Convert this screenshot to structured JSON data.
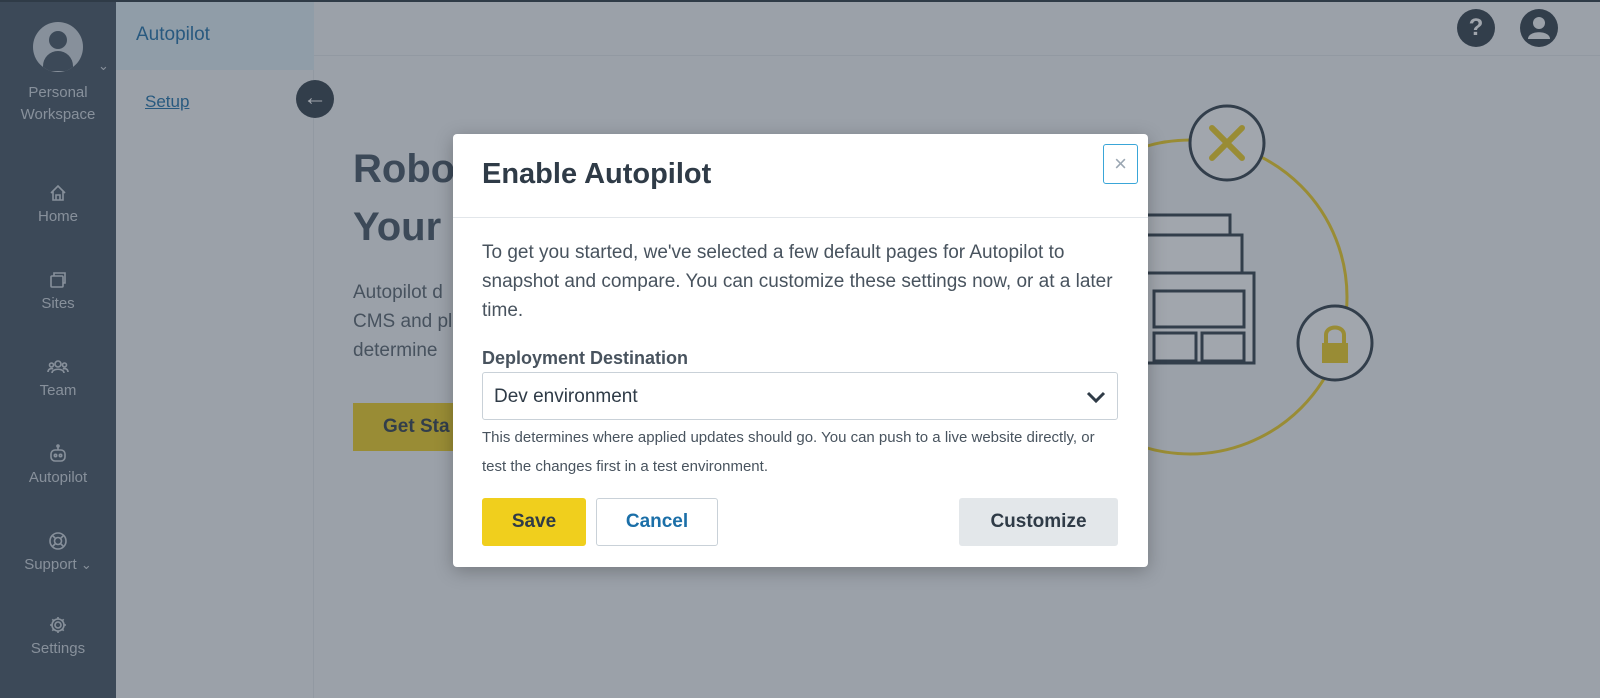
{
  "workspace": {
    "label_line1": "Personal",
    "label_line2": "Workspace"
  },
  "nav": {
    "items": [
      {
        "label": "Home",
        "icon": "home-icon"
      },
      {
        "label": "Sites",
        "icon": "sites-icon"
      },
      {
        "label": "Team",
        "icon": "team-icon"
      },
      {
        "label": "Autopilot",
        "icon": "robot-icon"
      },
      {
        "label": "Support",
        "icon": "lifebuoy-icon"
      },
      {
        "label": "Settings",
        "icon": "gear-icon"
      }
    ]
  },
  "subnav": {
    "title": "Autopilot",
    "link": "Setup"
  },
  "topbar": {
    "help_icon": "question-icon",
    "profile_icon": "user-icon"
  },
  "page": {
    "headline_line1": "Robot",
    "headline_line2": "Your",
    "body_line1": "Autopilot d",
    "body_line2": "CMS and pl",
    "body_line3": "determine",
    "cta": "Get Sta"
  },
  "modal": {
    "title": "Enable Autopilot",
    "close": "×",
    "description": "To get you started, we've selected a few default pages for Autopilot to snapshot and compare. You can customize these settings now, or at a later time.",
    "field_label": "Deployment Destination",
    "select_value": "Dev environment",
    "help_text": "This determines where applied updates should go. You can push to a live website directly, or test the changes first in a test environment.",
    "save_label": "Save",
    "cancel_label": "Cancel",
    "customize_label": "Customize"
  },
  "colors": {
    "nav_bg": "#41505f",
    "accent_yellow": "#f0cf1d",
    "link_blue": "#1b6fa8",
    "dark": "#2f3b47"
  }
}
